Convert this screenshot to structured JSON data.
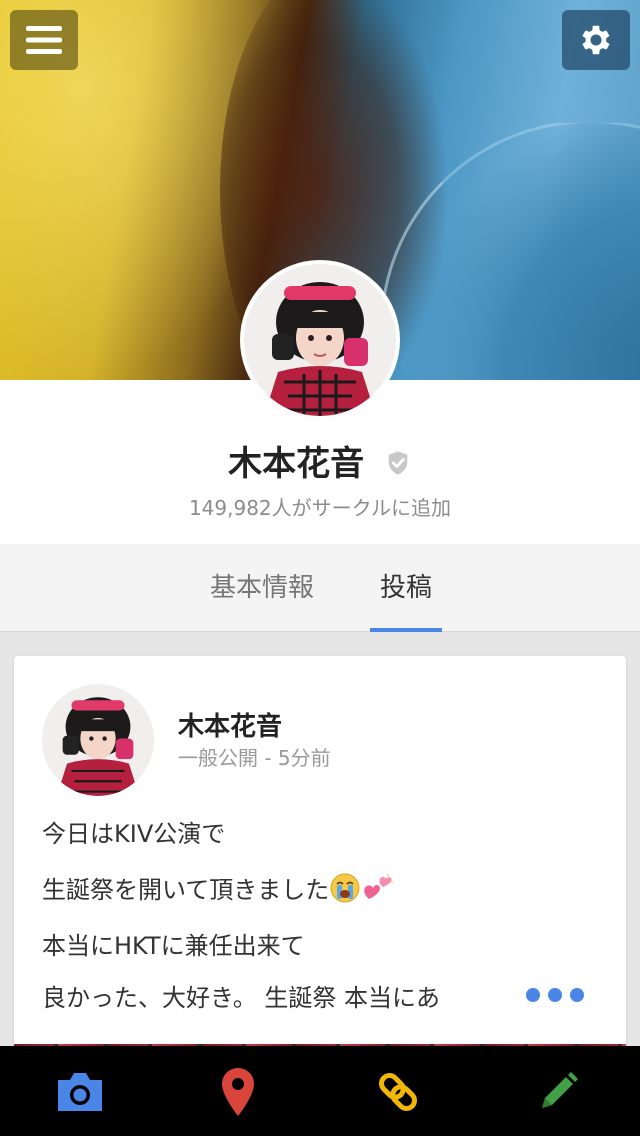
{
  "profile": {
    "name": "木本花音",
    "followers_text": "149,982人がサークルに追加"
  },
  "tabs": {
    "info_label": "基本情報",
    "posts_label": "投稿"
  },
  "post": {
    "author": "木本花音",
    "meta": "一般公開 - 5分前",
    "lines": [
      "今日はKIV公演で",
      "生誕祭を開いて頂きました",
      "本当にHKTに兼任出来て",
      "良かった、大好き。 生誕祭 本当にあ"
    ]
  },
  "icons": {
    "menu": "menu-icon",
    "settings": "gear-icon",
    "verified": "verified-shield-icon",
    "camera": "camera-icon",
    "place": "map-pin-icon",
    "link": "link-icon",
    "edit": "pencil-icon"
  },
  "colors": {
    "accent": "#4a86e8",
    "camera": "#4a86e8",
    "place": "#d9453a",
    "link": "#f2b705",
    "edit": "#43a047"
  }
}
